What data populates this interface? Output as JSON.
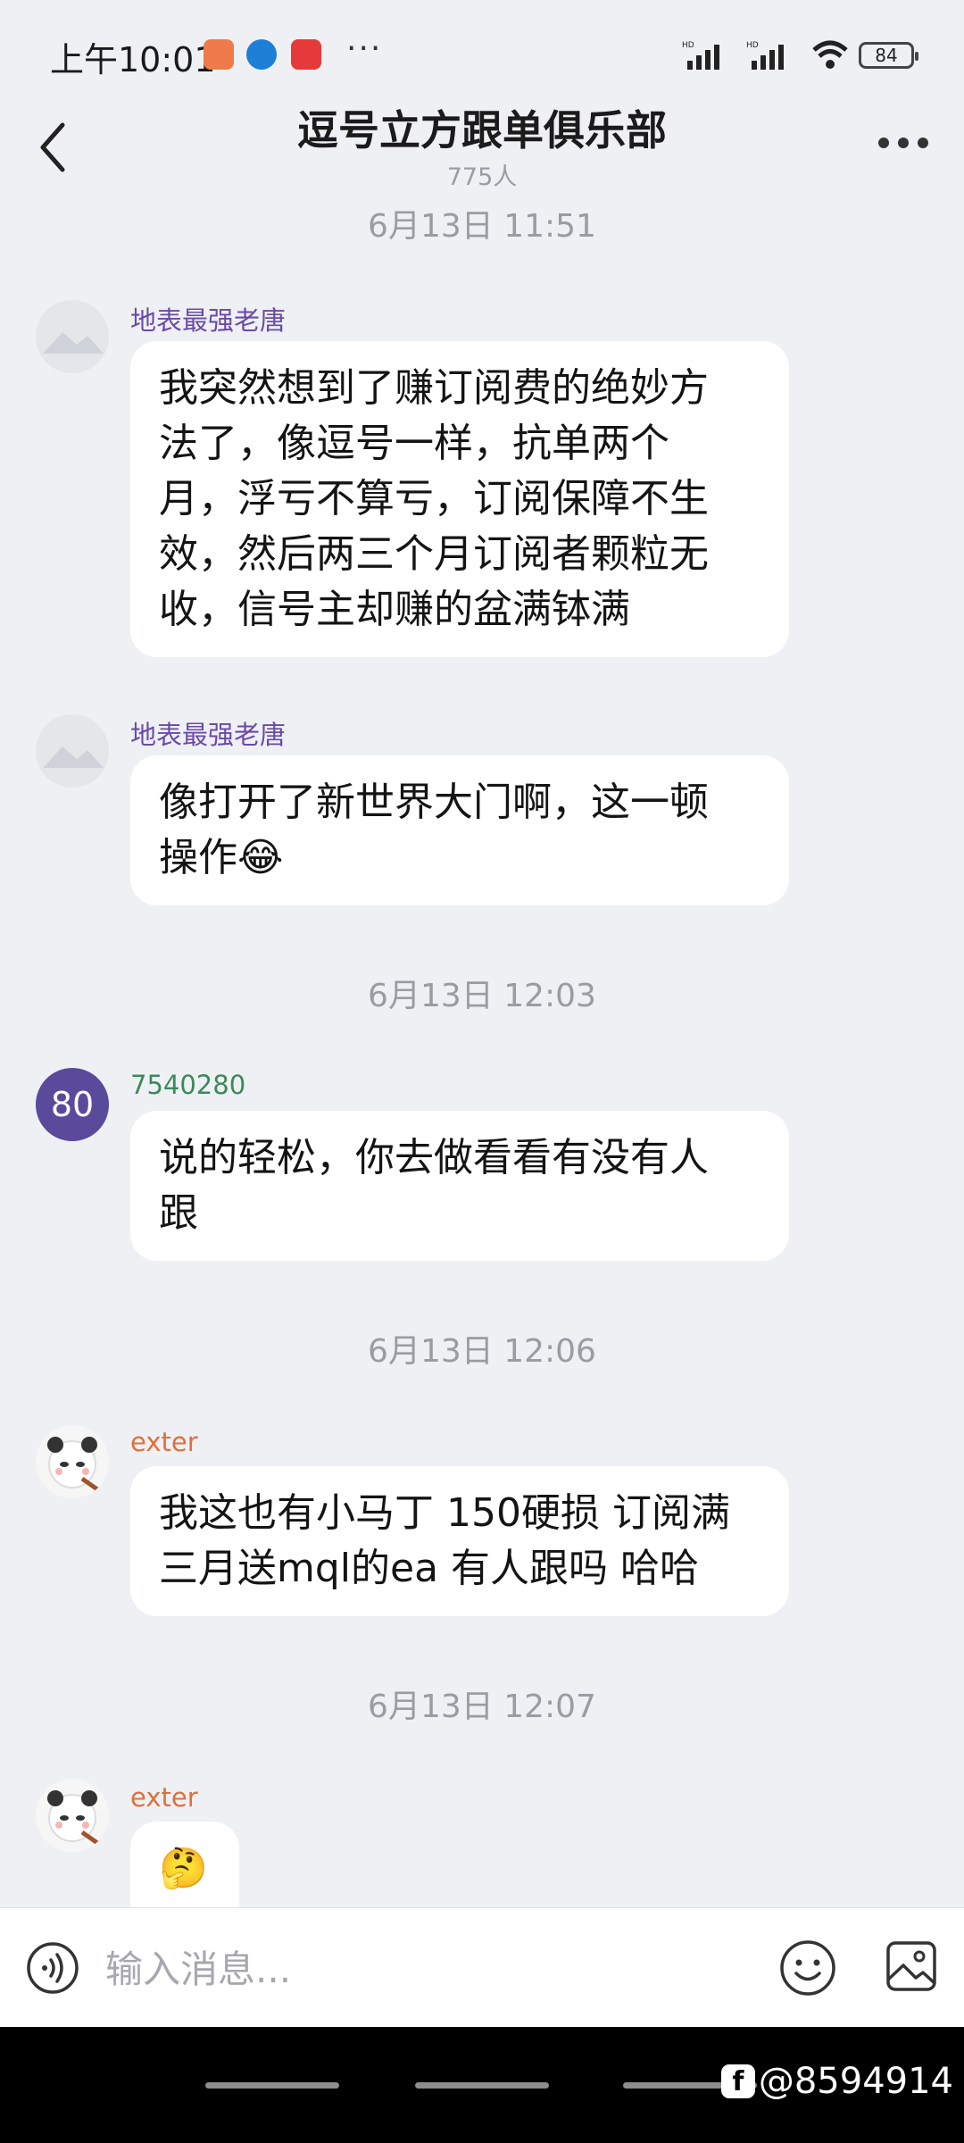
{
  "status_bar": {
    "time": "上午10:01",
    "dots": "···",
    "battery": "84",
    "app_icon_colors": [
      "#f07a4a",
      "#1e7fd6",
      "#e63a3a"
    ]
  },
  "header": {
    "title": "逗号立方跟单俱乐部",
    "member_count": "775人"
  },
  "messages": [
    {
      "time": "6月13日 11:51"
    },
    {
      "sender": "地表最强老唐",
      "sender_color": "#6a4aa8",
      "text_lines": [
        "我突然想到了赚订阅费的绝妙方",
        "法了，像逗号一样，抗单两个",
        "月，浮亏不算亏，订阅保障不生",
        "效，然后两三个月订阅者颗粒无",
        "收，信号主却赚的盆满钵满"
      ]
    },
    {
      "sender": "地表最强老唐",
      "sender_color": "#6a4aa8",
      "text_lines": [
        "像打开了新世界大门啊，这一顿",
        "操作😂"
      ]
    },
    {
      "time": "6月13日 12:03"
    },
    {
      "sender": "7540280",
      "sender_color": "#3b8a5a",
      "avatar_text": "80",
      "text_lines": [
        "说的轻松，你去做看看有没有人",
        "跟"
      ]
    },
    {
      "time": "6月13日 12:06"
    },
    {
      "sender": "exter",
      "sender_color": "#e0703a",
      "text_lines": [
        "我这也有小马丁 150硬损 订阅满",
        "三月送mql的ea 有人跟吗 哈哈"
      ]
    },
    {
      "time": "6月13日 12:07"
    },
    {
      "sender": "exter",
      "sender_color": "#e0703a",
      "text_lines": [
        "🤔"
      ]
    }
  ],
  "input": {
    "placeholder": "输入消息..."
  },
  "watermark": {
    "text": "@8594914"
  }
}
